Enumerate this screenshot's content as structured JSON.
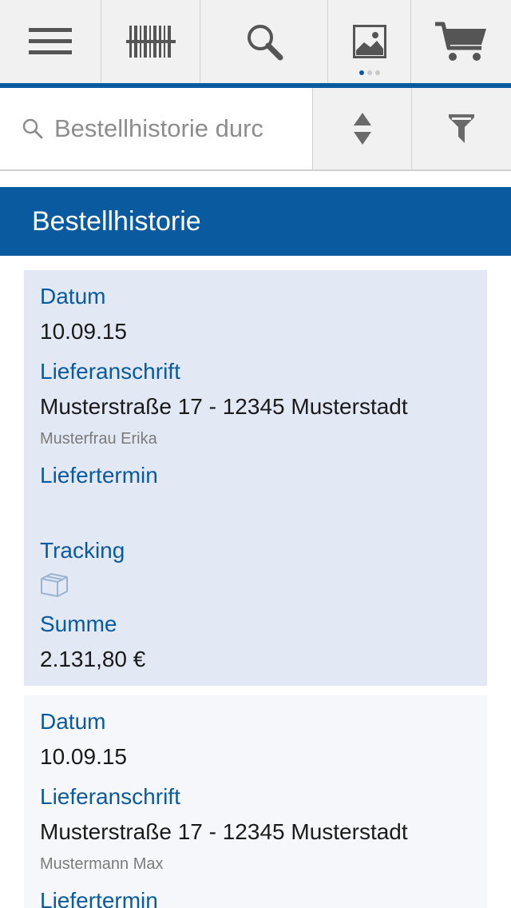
{
  "toolbar": {
    "items": [
      {
        "icon": "menu-icon"
      },
      {
        "icon": "barcode-icon"
      },
      {
        "icon": "search-icon"
      },
      {
        "icon": "image-icon"
      },
      {
        "icon": "cart-icon"
      }
    ],
    "accent_color": "#0a5aa0"
  },
  "search": {
    "placeholder": "Bestellhistorie durc"
  },
  "header": {
    "title": "Bestellhistorie"
  },
  "orders": [
    {
      "datum_label": "Datum",
      "datum": "10.09.15",
      "address_label": "Lieferanschrift",
      "address": "Musterstraße 17 - 12345 Musterstadt",
      "recipient": "Musterfrau Erika",
      "termin_label": "Liefertermin",
      "tracking_label": "Tracking",
      "summe_label": "Summe",
      "summe": "2.131,80 €"
    },
    {
      "datum_label": "Datum",
      "datum": "10.09.15",
      "address_label": "Lieferanschrift",
      "address": "Musterstraße 17 - 12345 Musterstadt",
      "recipient": "Mustermann Max",
      "termin_label": "Liefertermin"
    }
  ]
}
